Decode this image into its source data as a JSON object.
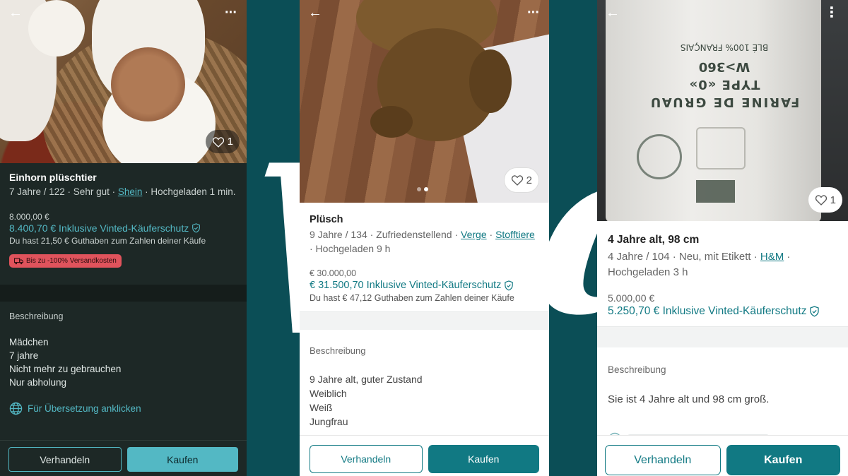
{
  "colors": {
    "brand_teal": "#117983",
    "dark_accent": "#53b8c4",
    "background": "#0b4e56",
    "badge_red": "#e0535c"
  },
  "icons": {
    "back": "arrow-left-icon",
    "more": "more-icon",
    "like": "heart-icon",
    "buyer_protection": "shield-check-icon",
    "shipping": "truck-icon",
    "translate": "globe-icon"
  },
  "glyphs": {
    "back": "←",
    "more": "⋮",
    "more_horizontal": "···"
  },
  "listings": [
    {
      "likes": "1",
      "title": "Einhorn plüschtier",
      "meta_before": "7 Jahre / 122 · Sehr gut · ",
      "brand": "Shein",
      "meta_after": " · Hochgeladen 1 min.",
      "price": "8.000,00 €",
      "price_total": "8.400,70 € Inklusive Vinted-Käuferschutz",
      "balance": "Du hast 21,50 € Guthaben zum Zahlen deiner Käufe",
      "shipping_badge": "Bis zu -100% Versandkosten",
      "description_label": "Beschreibung",
      "description": [
        "Mädchen",
        "7 jahre",
        "Nicht mehr zu gebrauchen",
        "Nur abholung"
      ],
      "translate": "Für Übersetzung anklicken",
      "negotiate": "Verhandeln",
      "buy": "Kaufen"
    },
    {
      "likes": "2",
      "title": "Plüsch",
      "meta_before": "9 Jahre / 134 · Zufriedenstellend · ",
      "brand": "Verge",
      "meta_mid": " · ",
      "brand2": "Stofftiere",
      "meta_after": " · Hochgeladen 9 h",
      "price": "€ 30.000,00",
      "price_total": "€ 31.500,70 Inklusive Vinted-Käuferschutz",
      "balance": "Du hast € 47,12 Guthaben zum Zahlen deiner Käufe",
      "description_label": "Beschreibung",
      "description": [
        "9 Jahre alt, guter Zustand",
        "Weiblich",
        "Weiß",
        "Jungfrau"
      ],
      "negotiate": "Verhandeln",
      "buy": "Kaufen"
    },
    {
      "likes": "1",
      "title": "4 Jahre alt, 98 cm",
      "meta_before": "4 Jahre / 104 · Neu, mit Etikett · ",
      "brand": "H&M",
      "meta_after": " · Hochgeladen 3 h",
      "price": "5.000,00 €",
      "price_total": "5.250,70 € Inklusive Vinted-Käuferschutz",
      "description_label": "Beschreibung",
      "description": [
        "Sie ist 4 Jahre alt und 98 cm groß."
      ],
      "negotiate": "Verhandeln",
      "buy": "Kaufen"
    }
  ],
  "bag_print": {
    "line1": "FARINE DE GRUAU",
    "line2": "TYPE «0»",
    "line3": "W>360",
    "line4": "BLÉ 100% FRANÇAIS"
  }
}
